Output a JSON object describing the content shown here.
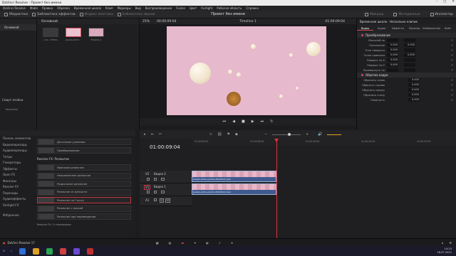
{
  "window": {
    "title": "DaVinci Resolve - Проект без имени"
  },
  "menu": [
    "DaVinci Resolve",
    "Файл",
    "Правка",
    "Обрезка",
    "Временная шкала",
    "Клип",
    "Маркеры",
    "Вид",
    "Воспроизведение",
    "Fusion",
    "Цвет",
    "Fairlight",
    "Рабочая область",
    "Справка"
  ],
  "toolbar": {
    "media": "Медиатека",
    "effects_lib": "Библиотека эффектов",
    "edit_index": "Индекс монтажа",
    "sound_lib": "Библиотека звуков",
    "project_title": "Проект без имени",
    "mixer": "Микшер",
    "metadata": "Метаданные",
    "inspector": "Инспектор"
  },
  "media_pool": {
    "tab": "Основной",
    "root": "Основной",
    "clips": [
      {
        "label": "...mix - 67069..."
      },
      {
        "label": "pexels-anton..."
      },
      {
        "label": "Timeline 1"
      }
    ],
    "smart_bins": "Смарт-ячейки",
    "keywords": "Keywords"
  },
  "viewer": {
    "zoom": "25%",
    "timecode_left": "00:00:09:04",
    "timeline_name": "Timeline 1",
    "timecode_right": "01:00:09:04"
  },
  "inspector": {
    "header": "Временная шкала - Несколько клипов",
    "tabs": [
      "Видео",
      "Аудио",
      "Эффекты",
      "Переход",
      "Изображение",
      "Файл"
    ],
    "transform_title": "Преобразование",
    "transform_rows": [
      {
        "label": "Масштаб по",
        "x": "",
        "y": ""
      },
      {
        "label": "Положение",
        "x": "0.000",
        "y": "0.000"
      },
      {
        "label": "Угол поворота",
        "x": "0.000",
        "y": ""
      },
      {
        "label": "Точка привязки",
        "x": "0.000",
        "y": "0.000"
      },
      {
        "label": "Поворот по X",
        "x": "0.000",
        "y": ""
      },
      {
        "label": "Поворот по Y",
        "x": "0.000",
        "y": ""
      },
      {
        "label": "Перевернуть по",
        "x": "",
        "y": ""
      }
    ],
    "crop_title": "Обрезка кадра",
    "crop_rows": [
      {
        "label": "Обрезать слева",
        "x": "0.000"
      },
      {
        "label": "Обрезать справа",
        "x": "0.000"
      },
      {
        "label": "Обрезать сверху",
        "x": "0.000"
      },
      {
        "label": "Обрезать снизу",
        "x": "0.000"
      },
      {
        "label": "Плавность",
        "x": "0.000"
      }
    ]
  },
  "fx_library": {
    "tree": [
      "Панель элементов",
      "Видеопереходы",
      "Аудиопереходы",
      "Титры",
      "Генераторы",
      "Эффекты",
      "Open FX",
      "Фильтры",
      "Resolve FX",
      "Переходы",
      "Аудиоэффекты",
      "Fairlight FX",
      "Избранное"
    ],
    "top_items": [
      "Детальное усиление",
      "Преобразование"
    ],
    "group_title": "Resolve FX: Размытие",
    "items": [
      "Ирисовое размытие",
      "Направленное размытие",
      "Радиальное размытие",
      "Размытие от резкости",
      "Размытие по Гауссу",
      "Размытие с маской",
      "Размытие при перемещении"
    ],
    "selected_index": 4,
    "next_group": "Resolve FX: Сглаживание"
  },
  "timeline": {
    "timecode": "01:00:09:04",
    "ruler_marks": [
      "01:00:00:00",
      "01:00:08:00",
      "01:00:16:00",
      "01:00:24:00",
      "01:00:32:00"
    ],
    "tracks": [
      {
        "id": "V2",
        "name": "Видео 2",
        "clip_label": "pexels-anton-pvdms-5424014.mp4"
      },
      {
        "id": "V1",
        "name": "Видео 1",
        "clip_label": "pexels-anton-pvdms-5424014.mp4"
      },
      {
        "id": "A1",
        "name": "",
        "clip_label": ""
      }
    ]
  },
  "status": {
    "app_version": "DaVinci Resolve 17"
  },
  "taskbar": {
    "clock": "14:23",
    "date": "28.07.2021"
  },
  "colors": {
    "accent": "#d04a5a",
    "playhead": "#e0303c",
    "clip_blue": "#3f5a8f",
    "video_pink": "#e7b9cc"
  }
}
